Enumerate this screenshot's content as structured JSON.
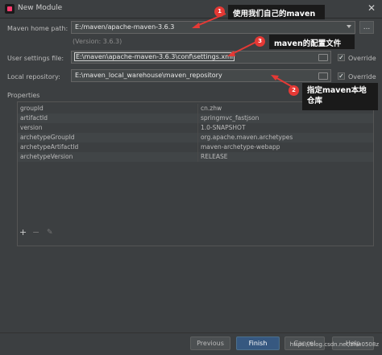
{
  "window": {
    "title": "New Module",
    "close_glyph": "✕"
  },
  "maven": {
    "home_label": "Maven home path:",
    "home_value": "E:/maven/apache-maven-3.6.3",
    "version_hint": "(Version: 3.6.3)",
    "settings_label": "User settings file:",
    "settings_value": "E:\\maven\\apache-maven-3.6.3\\conf\\settings.xml",
    "repo_label": "Local repository:",
    "repo_value": "E:\\maven_local_warehouse\\maven_repository",
    "override_label": "Override",
    "ellipsis": "..."
  },
  "properties": {
    "label": "Properties",
    "rows": [
      {
        "key": "groupId",
        "value": "cn.zhw"
      },
      {
        "key": "artifactId",
        "value": "springmvc_fastjson"
      },
      {
        "key": "version",
        "value": "1.0-SNAPSHOT"
      },
      {
        "key": "archetypeGroupId",
        "value": "org.apache.maven.archetypes"
      },
      {
        "key": "archetypeArtifactId",
        "value": "maven-archetype-webapp"
      },
      {
        "key": "archetypeVersion",
        "value": "RELEASE"
      }
    ],
    "toolbar": {
      "add": "+",
      "remove": "−",
      "edit": "✎"
    }
  },
  "buttons": {
    "previous": "Previous",
    "finish": "Finish",
    "cancel": "Cancel",
    "help": "Help"
  },
  "annotations": [
    {
      "num": "1",
      "text": "使用我们自己的maven"
    },
    {
      "num": "3",
      "text": "maven的配置文件"
    },
    {
      "num": "2",
      "text": "指定maven本地仓库"
    }
  ],
  "watermark": "https://blog.csdn.net/zhw0508z"
}
